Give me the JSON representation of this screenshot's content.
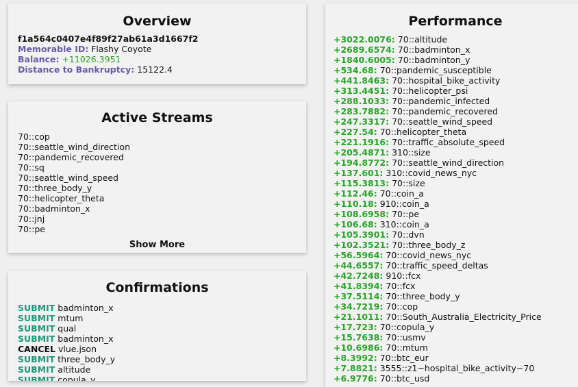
{
  "overview": {
    "title": "Overview",
    "hash": "f1a564c0407e4f89f27ab61a3d1667f2",
    "memorable_label": "Memorable ID:",
    "memorable_value": "Flashy Coyote",
    "balance_label": "Balance:",
    "balance_value": "+11026.3951",
    "bankruptcy_label": "Distance to Bankruptcy:",
    "bankruptcy_value": "15122.4"
  },
  "streams": {
    "title": "Active Streams",
    "items": [
      "70::cop",
      "70::seattle_wind_direction",
      "70::pandemic_recovered",
      "70::sq",
      "70::seattle_wind_speed",
      "70::three_body_y",
      "70::helicopter_theta",
      "70::badminton_x",
      "70::jnj",
      "70::pe"
    ],
    "show_more": "Show More"
  },
  "confirmations": {
    "title": "Confirmations",
    "items": [
      {
        "action": "SUBMIT",
        "name": "badminton_x"
      },
      {
        "action": "SUBMIT",
        "name": "mtum"
      },
      {
        "action": "SUBMIT",
        "name": "qual"
      },
      {
        "action": "SUBMIT",
        "name": "badminton_x"
      },
      {
        "action": "CANCEL",
        "name": "vlue.json"
      },
      {
        "action": "SUBMIT",
        "name": "three_body_y"
      },
      {
        "action": "SUBMIT",
        "name": "altitude"
      },
      {
        "action": "SUBMIT",
        "name": "copula_y"
      }
    ]
  },
  "performance": {
    "title": "Performance",
    "items": [
      {
        "delta": "+3022.0076:",
        "name": "70::altitude"
      },
      {
        "delta": "+2689.6574:",
        "name": "70::badminton_x"
      },
      {
        "delta": "+1840.6005:",
        "name": "70::badminton_y"
      },
      {
        "delta": "+534.68:",
        "name": "70::pandemic_susceptible"
      },
      {
        "delta": "+441.8463:",
        "name": "70::hospital_bike_activity"
      },
      {
        "delta": "+313.4451:",
        "name": "70::helicopter_psi"
      },
      {
        "delta": "+288.1033:",
        "name": "70::pandemic_infected"
      },
      {
        "delta": "+283.7882:",
        "name": "70::pandemic_recovered"
      },
      {
        "delta": "+247.3317:",
        "name": "70::seattle_wind_speed"
      },
      {
        "delta": "+227.54:",
        "name": "70::helicopter_theta"
      },
      {
        "delta": "+221.1916:",
        "name": "70::traffic_absolute_speed"
      },
      {
        "delta": "+205.4871:",
        "name": "310::size"
      },
      {
        "delta": "+194.8772:",
        "name": "70::seattle_wind_direction"
      },
      {
        "delta": "+137.601:",
        "name": "310::covid_news_nyc"
      },
      {
        "delta": "+115.3813:",
        "name": "70::size"
      },
      {
        "delta": "+112.46:",
        "name": "70::coin_a"
      },
      {
        "delta": "+110.18:",
        "name": "910::coin_a"
      },
      {
        "delta": "+108.6958:",
        "name": "70::pe"
      },
      {
        "delta": "+106.68:",
        "name": "310::coin_a"
      },
      {
        "delta": "+105.3901:",
        "name": "70::dvn"
      },
      {
        "delta": "+102.3521:",
        "name": "70::three_body_z"
      },
      {
        "delta": "+56.5964:",
        "name": "70::covid_news_nyc"
      },
      {
        "delta": "+44.6557:",
        "name": "70::traffic_speed_deltas"
      },
      {
        "delta": "+42.7248:",
        "name": "910::fcx"
      },
      {
        "delta": "+41.8394:",
        "name": "70::fcx"
      },
      {
        "delta": "+37.5114:",
        "name": "70::three_body_y"
      },
      {
        "delta": "+34.7219:",
        "name": "70::cop"
      },
      {
        "delta": "+21.1011:",
        "name": "70::South_Australia_Electricity_Price"
      },
      {
        "delta": "+17.723:",
        "name": "70::copula_y"
      },
      {
        "delta": "+15.7638:",
        "name": "70::usmv"
      },
      {
        "delta": "+10.6986:",
        "name": "70::mtum"
      },
      {
        "delta": "+8.3992:",
        "name": "70::btc_eur"
      },
      {
        "delta": "+7.8821:",
        "name": "3555::z1~hospital_bike_activity~70"
      },
      {
        "delta": "+6.9776:",
        "name": "70::btc_usd"
      }
    ]
  }
}
